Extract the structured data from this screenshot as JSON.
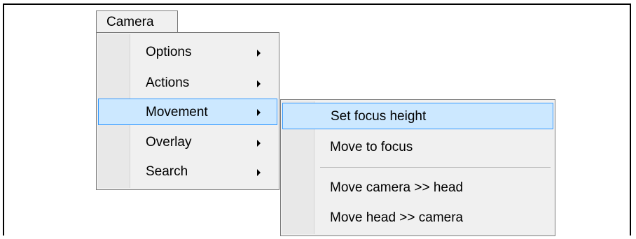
{
  "menubar": {
    "camera_label": "Camera"
  },
  "main_menu": {
    "items": [
      {
        "label": "Options",
        "has_submenu": true,
        "highlighted": false
      },
      {
        "label": "Actions",
        "has_submenu": true,
        "highlighted": false
      },
      {
        "label": "Movement",
        "has_submenu": true,
        "highlighted": true
      },
      {
        "label": "Overlay",
        "has_submenu": true,
        "highlighted": false
      },
      {
        "label": "Search",
        "has_submenu": true,
        "highlighted": false
      }
    ]
  },
  "movement_submenu": {
    "items": [
      {
        "label": "Set focus height",
        "highlighted": true
      },
      {
        "label": "Move to focus",
        "highlighted": false
      },
      {
        "label": "Move camera >> head",
        "highlighted": false
      },
      {
        "label": "Move head >> camera",
        "highlighted": false
      }
    ]
  },
  "colors": {
    "menu_background": "#f0f0f0",
    "highlight_fill": "#cce8ff",
    "highlight_border": "#3399ff"
  }
}
